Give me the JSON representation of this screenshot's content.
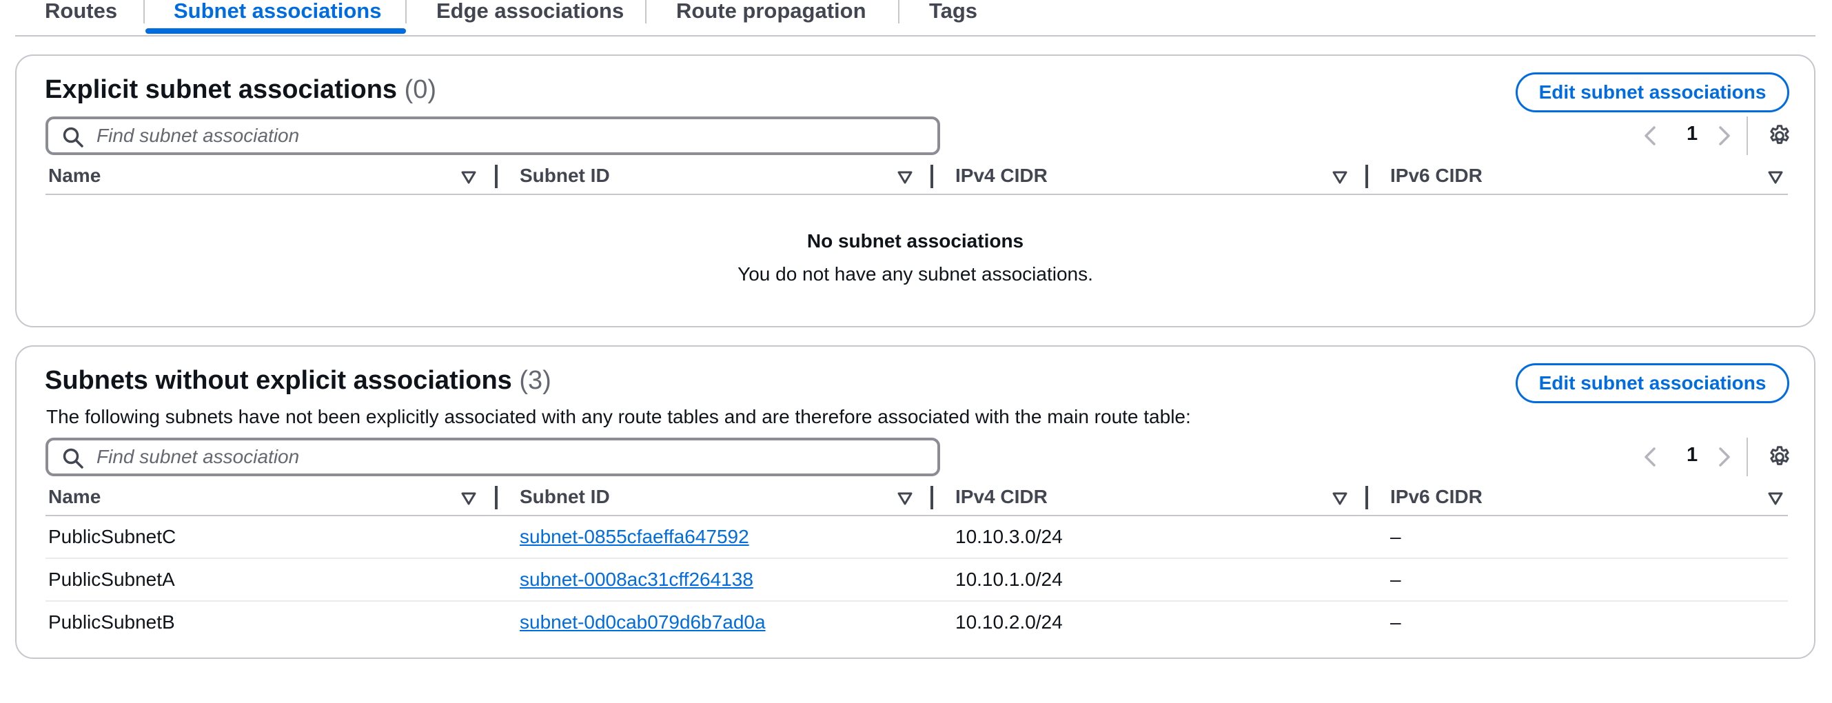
{
  "tabs": [
    {
      "label": "Routes",
      "active": false
    },
    {
      "label": "Subnet associations",
      "active": true
    },
    {
      "label": "Edge associations",
      "active": false
    },
    {
      "label": "Route propagation",
      "active": false
    },
    {
      "label": "Tags",
      "active": false
    }
  ],
  "explicit": {
    "title": "Explicit subnet associations",
    "count": "(0)",
    "edit_label": "Edit subnet associations",
    "search_placeholder": "Find subnet association",
    "page": "1",
    "columns": [
      "Name",
      "Subnet ID",
      "IPv4 CIDR",
      "IPv6 CIDR"
    ],
    "empty_title": "No subnet associations",
    "empty_message": "You do not have any subnet associations."
  },
  "implicit": {
    "title": "Subnets without explicit associations",
    "count": "(3)",
    "description": "The following subnets have not been explicitly associated with any route tables and are therefore associated with the main route table:",
    "edit_label": "Edit subnet associations",
    "search_placeholder": "Find subnet association",
    "page": "1",
    "columns": [
      "Name",
      "Subnet ID",
      "IPv4 CIDR",
      "IPv6 CIDR"
    ],
    "rows": [
      {
        "name": "PublicSubnetC",
        "subnet_id": "subnet-0855cfaeffa647592",
        "ipv4": "10.10.3.0/24",
        "ipv6": "–"
      },
      {
        "name": "PublicSubnetA",
        "subnet_id": "subnet-0008ac31cff264138",
        "ipv4": "10.10.1.0/24",
        "ipv6": "–"
      },
      {
        "name": "PublicSubnetB",
        "subnet_id": "subnet-0d0cab079d6b7ad0a",
        "ipv4": "10.10.2.0/24",
        "ipv6": "–"
      }
    ]
  },
  "colors": {
    "accent": "#006ce0",
    "text": "#0f141a",
    "border": "#c6c6cd"
  }
}
